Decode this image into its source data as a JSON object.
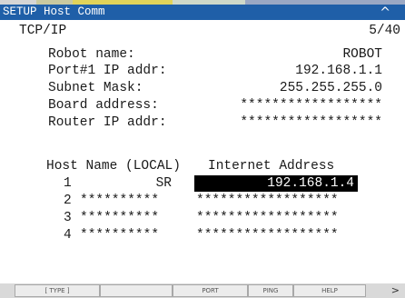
{
  "title_bar": {
    "title": "SETUP Host Comm",
    "caret": "^"
  },
  "top_strip": {
    "colors": [
      "#d5d5d5",
      "#c9c9a0",
      "#e1d35a",
      "#e1d35a",
      "#cfd9c9",
      "#9aa8c4"
    ]
  },
  "header": {
    "protocol": "TCP/IP",
    "page": "5/40"
  },
  "fields": [
    {
      "label": "Robot name:",
      "value": "ROBOT"
    },
    {
      "label": "Port#1 IP addr:",
      "value": "192.168.1.1"
    },
    {
      "label": "Subnet Mask:",
      "value": "255.255.255.0"
    },
    {
      "label": "Board address:",
      "value": "******************"
    },
    {
      "label": "Router IP addr:",
      "value": "******************"
    }
  ],
  "host_table": {
    "header_name": "Host Name (LOCAL)",
    "header_address": "Internet Address",
    "rows": [
      {
        "num": "1",
        "name": "SR",
        "address": "192.168.1.4",
        "selected": true
      },
      {
        "num": "2",
        "name": "**********",
        "address": "******************",
        "selected": false
      },
      {
        "num": "3",
        "name": "**********",
        "address": "******************",
        "selected": false
      },
      {
        "num": "4",
        "name": "**********",
        "address": "******************",
        "selected": false
      }
    ]
  },
  "function_keys": [
    "[ TYPE ]",
    "",
    "PORT",
    "PING",
    "HELP"
  ],
  "next_key": ">"
}
